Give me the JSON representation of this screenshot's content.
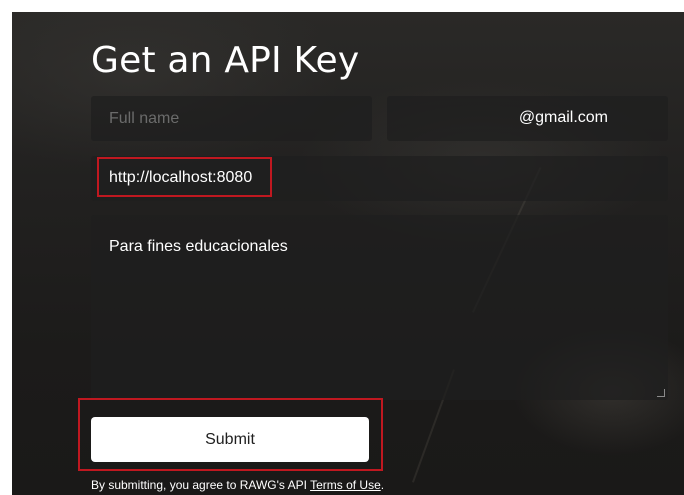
{
  "page": {
    "title": "Get an API Key"
  },
  "form": {
    "full_name": {
      "placeholder": "Full name",
      "value": ""
    },
    "email": {
      "value": "@gmail.com"
    },
    "website": {
      "value": "http://localhost:8080"
    },
    "description": {
      "value": "Para fines educacionales"
    },
    "submit_label": "Submit",
    "terms_prefix": "By submitting, you agree to RAWG's API ",
    "terms_link": "Terms of Use",
    "terms_suffix": "."
  },
  "colors": {
    "highlight": "#c01820",
    "button_bg": "#ffffff",
    "text": "#ffffff"
  }
}
